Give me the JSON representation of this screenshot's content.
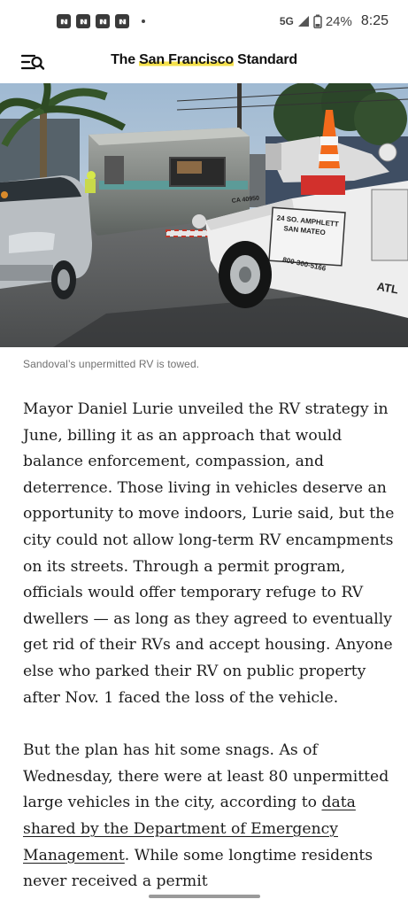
{
  "status_bar": {
    "notifications": [
      "news-notification-icon",
      "news-notification-icon",
      "news-notification-icon",
      "news-notification-icon"
    ],
    "network": "5G",
    "battery": "24%",
    "time": "8:25"
  },
  "header": {
    "logo_prefix": "The ",
    "logo_highlight": "San Francisco",
    "logo_suffix": " Standard"
  },
  "photo": {
    "icon": "rv-tow-photo",
    "tow_door_line1": "24 SO. AMPHLETT",
    "tow_door_line2": "SAN MATEO",
    "tow_phone": "800-300-5166",
    "tow_id": "CA 40950",
    "tow_brand": "ATL"
  },
  "caption": "Sandoval’s unpermitted RV is towed.",
  "article": {
    "p1": "Mayor Daniel Lurie unveiled the RV strategy in June, billing it as an approach that would balance enforcement, compassion, and deterrence. Those living in vehicles deserve an opportunity to move indoors, Lurie said, but the city could not allow long-term RV encampments on its streets. Through a permit program, officials would offer temporary refuge to RV dwellers — as long as they agreed to eventually get rid of their RVs and accept housing. Anyone else who parked their RV on public property after Nov. 1 faced the loss of the vehicle.",
    "p2_before": "But the plan has hit some snags. As of Wednesday, there were at least 80 unpermitted large vehicles in the city, according to ",
    "p2_link": "data shared by the Department of Emergency Management",
    "p2_after": ". While some longtime residents never received a permit"
  }
}
